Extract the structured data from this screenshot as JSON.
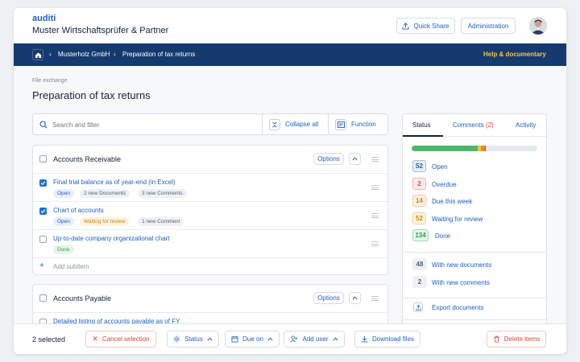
{
  "app": {
    "brand": "auditi",
    "company": "Muster Wirtschaftsprüfer & Partner"
  },
  "header": {
    "quick_share": "Quick Share",
    "administration": "Administration"
  },
  "breadcrumb": {
    "client": "Musterholz GmbH",
    "current": "Preparation of tax returns",
    "help": "Help & documentary"
  },
  "page": {
    "label": "File exchange",
    "title": "Preparation of tax returns"
  },
  "search": {
    "placeholder": "Search and filter",
    "collapse_label": "Collapse all",
    "function_label": "Function"
  },
  "groups": [
    {
      "title": "Accounts Receivable",
      "options_label": "Options",
      "items": [
        {
          "title": "Final trial balance as of year-end (in Excel)",
          "checked": true,
          "tags": [
            "Open",
            "2 new Documents",
            "3 new Comments"
          ]
        },
        {
          "title": "Chart of accounts",
          "checked": true,
          "tags": [
            "Open",
            "Waiting for review",
            "1 new Comment"
          ]
        },
        {
          "title": "Up-to-date company organizational chart",
          "checked": false,
          "tags": [
            "Done"
          ]
        }
      ],
      "add_subitem": "Add subitem"
    },
    {
      "title": "Accounts Payable",
      "options_label": "Options",
      "items": [
        {
          "title": "Detailed listing of accounts payable as of FY",
          "checked": false,
          "tags": []
        }
      ]
    }
  ],
  "sidebar": {
    "tabs": {
      "status": "Status",
      "comments": "Comments",
      "comments_count": "(2)",
      "activity": "Activity"
    },
    "progress": {
      "open": 52,
      "overdue": 2,
      "due_this_week": 14,
      "waiting": 52,
      "done": 134
    },
    "stats": [
      {
        "count": "52",
        "label": "Open",
        "color": "#1f5fbf",
        "bg": "#e6eef9"
      },
      {
        "count": "2",
        "label": "Overdue",
        "color": "#d9463b",
        "bg": "#fdeceb"
      },
      {
        "count": "14",
        "label": "Due this week",
        "color": "#d9821e",
        "bg": "#fff1e0"
      },
      {
        "count": "52",
        "label": "Waiting for review",
        "color": "#c98316",
        "bg": "#fff5df"
      },
      {
        "count": "134",
        "label": "Done",
        "color": "#2f9e4d",
        "bg": "#e4f5e8"
      }
    ],
    "extras": [
      {
        "count": "48",
        "label": "With new documents"
      },
      {
        "count": "2",
        "label": "With new comments"
      }
    ],
    "export_label": "Export documents"
  },
  "bottom": {
    "selected": "2 selected",
    "cancel": "Cancel selection",
    "status": "Status",
    "due_on": "Due on",
    "add_user": "Add user",
    "download": "Download files",
    "delete": "Delete items"
  },
  "colors": {
    "navy": "#153a6e",
    "accent": "#1f5fbf",
    "help": "#f5c342",
    "done": "#4cb86a",
    "open": "#e4e8ef",
    "waiting": "#f5c342",
    "due": "#f08a24",
    "overdue": "#d9463b"
  }
}
